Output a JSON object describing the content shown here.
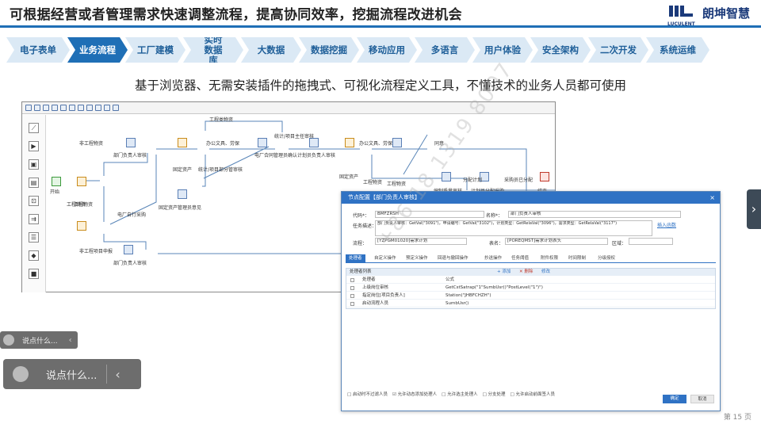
{
  "slide": {
    "title": "可根据经营或者管理需求快速调整流程，提高协同效率，挖掘流程改进机会",
    "subtitle": "基于浏览器、无需安装插件的拖拽式、可视化流程定义工具，不懂技术的业务人员都可使用",
    "page_number": "第 15 页"
  },
  "logo": {
    "brand": "朗坤智慧",
    "sub": "LUCULENT"
  },
  "nav": {
    "items": [
      "电子表单",
      "业务流程",
      "工厂建模",
      "实时数据库",
      "大数据",
      "数据挖掘",
      "移动应用",
      "多语言",
      "用户体验",
      "安全架构",
      "二次开发",
      "系统运维"
    ],
    "active_index": 1
  },
  "designer": {
    "palette_icons": [
      "line-tool-icon",
      "start-node-icon",
      "task-node-icon",
      "form-node-icon",
      "subprocess-icon",
      "merge-icon",
      "list-icon",
      "gateway-icon",
      "end-node-icon"
    ],
    "labels": {
      "start": "开始",
      "n1": "工程物资",
      "n2": "部门负责人审核",
      "n3": "电厂合同管理员确认",
      "n4": "计划员负责人审核",
      "n5": "编制质量审核",
      "n6": "计划员分配采购",
      "end": "结束",
      "n7": "固定资产管理员意见",
      "n8": "部门负责人审核",
      "e1": "非工程物资",
      "e2": "工程类物资",
      "e3": "办公文具、劳保",
      "e4": "固定资产",
      "e5": "统计/项目主任审核",
      "e6": "电厂自行采购",
      "e7": "非工程项目申报",
      "e8": "工程物资",
      "e9": "同意",
      "e10": "工程物资",
      "e11": "办公文具、劳保",
      "e12": "固定资产",
      "e13": "分配计划",
      "e14": "采购员已分配",
      "e15": "统计/项目部分管审核",
      "e16": "工程物资"
    }
  },
  "dialog": {
    "title": "节点配置【部门负责人审核】",
    "close": "×",
    "code_label": "代码*：",
    "code_value": "BMFZRSH",
    "name_label": "名称*：",
    "name_value": "部门负责人审核",
    "desc_label": "任务描述：",
    "desc_value": "部门负责人审核：GetVal(\"3091\")，申请编号：GetVal(\"3102\")，计划类型：GetRelaVal(\"3096\")，需求类型：GetRelaVal(\"3117\")",
    "insert_link": "插入函数",
    "flow_label": "流程：",
    "flow_value": "[YZPGM01020]需求计划",
    "table_label": "表名：",
    "table_value": "[POREQMST]需求计划表头",
    "area_label": "区域：",
    "area_value": "",
    "tabs": [
      "处理者",
      "自定义操作",
      "预定义操作",
      "回退与撤回操作",
      "抄送操作",
      "任务阈值",
      "附件权限",
      "时间限制",
      "分级授权"
    ],
    "active_tab": 0,
    "grid_title": "处理者列表",
    "grid_actions": [
      "+ 添加",
      "✕ 删除",
      "修改"
    ],
    "grid_rows": [
      [
        "处理者",
        "公式"
      ],
      [
        "上级岗位审核",
        "GetCstSatrap(\"1\"SumbUsr()\"PostLevel(\"1\")\")"
      ],
      [
        "指定岗位[项目负责人]",
        "Station(\"JHBFCHZH\")"
      ],
      [
        "启动流程人员",
        "SumbUsr()"
      ]
    ],
    "footer_options": [
      "□ 启动时不过滤人员",
      "☑ 允许动态添加处理人",
      "□ 允许选主处理人",
      "□ 分支处理",
      "□ 允许启动前面签人员"
    ],
    "ok_label": "确定",
    "cancel_label": "取消"
  },
  "watermark": "+86 18 1319 8007",
  "chat_small": {
    "placeholder": "说点什么...",
    "arrow": "‹"
  },
  "chat_large": {
    "placeholder": "说点什么...",
    "arrow": "‹"
  },
  "side_arrow": "›",
  "colors": {
    "accent": "#1f6fb6",
    "nav_inactive": "#dbe9f5",
    "dialog_header": "#2f72c4"
  }
}
